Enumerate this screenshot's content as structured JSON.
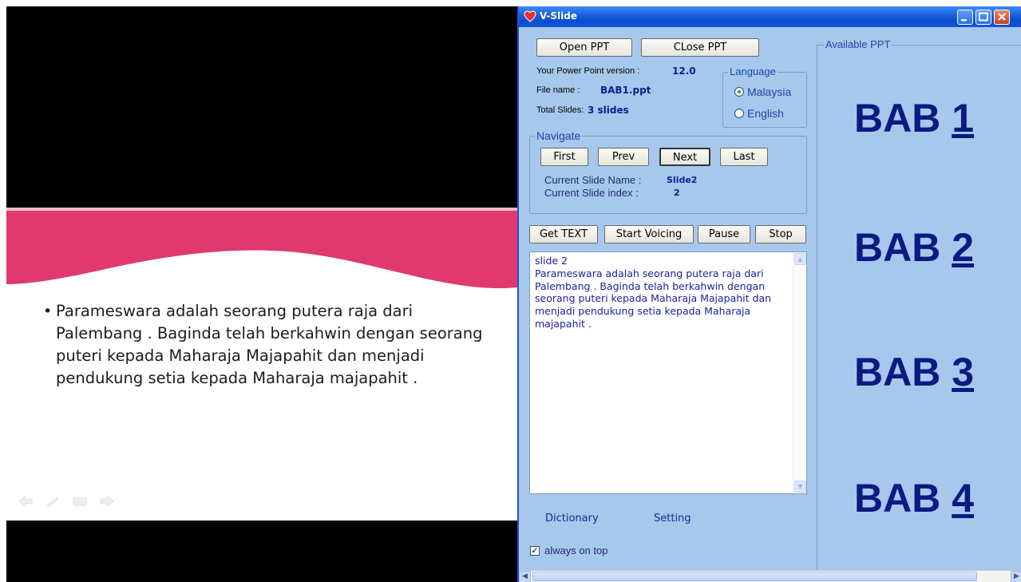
{
  "slide": {
    "bullet": "Parameswara adalah seorang putera raja dari Palembang . Baginda telah berkahwin dengan seorang puteri kepada Maharaja Majapahit dan menjadi pendukung setia kepada Maharaja majapahit .",
    "accent_color": "#e0396e"
  },
  "window": {
    "title": "V-Slide",
    "open_button": "Open PPT",
    "close_button": "CLose PPT",
    "version_label": "Your Power Point version :",
    "version_value": "12.0",
    "filename_label": "File name :",
    "filename_value": "BAB1.ppt",
    "total_label": "Total Slides:",
    "total_value": "3 slides",
    "language": {
      "legend": "Language",
      "options": [
        "Malaysia",
        "English"
      ],
      "selected": "Malaysia"
    },
    "navigate": {
      "legend": "Navigate",
      "buttons": [
        "First",
        "Prev",
        "Next",
        "Last"
      ],
      "current_name_label": "Current Slide Name :",
      "current_name_value": "Slide2",
      "current_index_label": "Current Slide index :",
      "current_index_value": "2"
    },
    "voice": {
      "get_text": "Get TEXT",
      "start_voicing": "Start Voicing",
      "pause": "Pause",
      "stop": "Stop"
    },
    "text_content": "slide 2\nParameswara adalah seorang putera raja dari Palembang . Baginda telah berkahwin dengan seorang puteri kepada Maharaja Majapahit dan menjadi pendukung setia kepada Maharaja majapahit .",
    "dictionary": "Dictionary",
    "setting": "Setting",
    "always_on_top": "always on top",
    "always_on_top_checked": true,
    "available_legend": "Available PPT",
    "bab_items": [
      {
        "word": "BAB",
        "num": "1"
      },
      {
        "word": "BAB",
        "num": "2"
      },
      {
        "word": "BAB",
        "num": "3"
      },
      {
        "word": "BAB",
        "num": "4"
      }
    ]
  }
}
